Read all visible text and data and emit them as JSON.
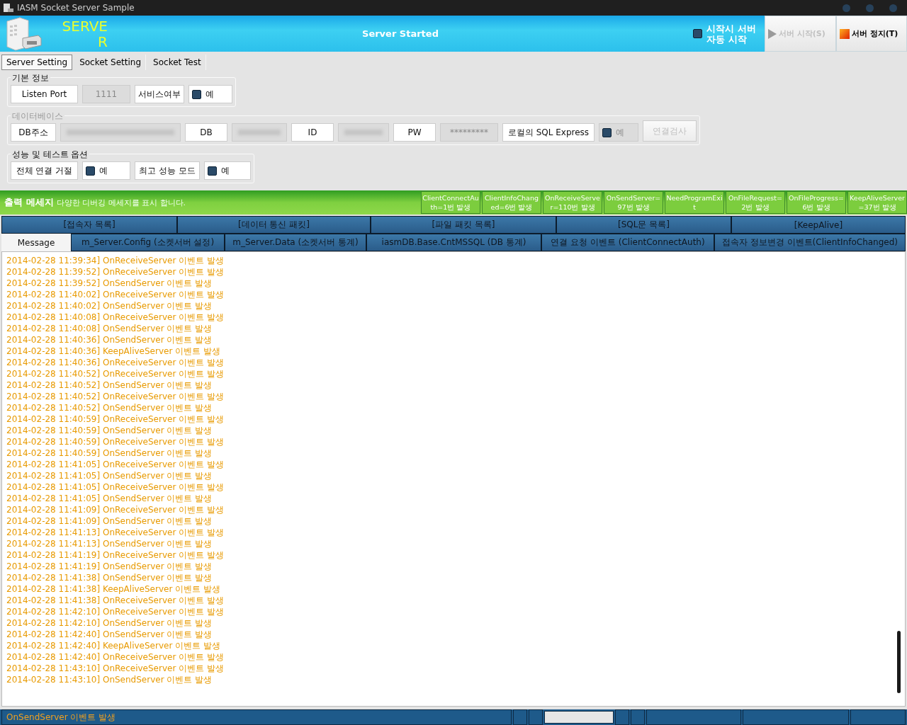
{
  "window": {
    "title": "IASM Socket Server Sample"
  },
  "header": {
    "logo_text": "SERVER",
    "status": "Server Started",
    "auto_start": {
      "label": "시작시 서버 자동 시작",
      "checked": false
    },
    "buttons": [
      {
        "label": "서버 시작(S)",
        "kind": "play",
        "disabled": true
      },
      {
        "label": "서버 정지(T)",
        "kind": "stop",
        "disabled": false
      }
    ]
  },
  "tabs": [
    {
      "label": "Server Setting",
      "selected": true
    },
    {
      "label": "Socket Setting",
      "selected": false
    },
    {
      "label": "Socket Test",
      "selected": false
    }
  ],
  "groups": [
    {
      "title": "기본 정보",
      "disabled": false,
      "items": [
        {
          "kind": "label",
          "text": "Listen Port"
        },
        {
          "kind": "value",
          "text": "1111"
        },
        {
          "kind": "label",
          "text": "서비스여부"
        },
        {
          "kind": "check",
          "text": "예",
          "checked": false,
          "disabled": false
        }
      ]
    },
    {
      "title": "데이터베이스",
      "disabled": true,
      "items": [
        {
          "kind": "label",
          "text": "DB주소"
        },
        {
          "kind": "blurred"
        },
        {
          "kind": "label",
          "text": "DB"
        },
        {
          "kind": "blurred"
        },
        {
          "kind": "label",
          "text": "ID"
        },
        {
          "kind": "blurred"
        },
        {
          "kind": "label",
          "text": "PW"
        },
        {
          "kind": "value",
          "text": "*********"
        },
        {
          "kind": "label",
          "text": "로컬의 SQL Express"
        },
        {
          "kind": "check",
          "text": "예",
          "checked": false,
          "disabled": true
        },
        {
          "kind": "button",
          "text": "연결검사",
          "disabled": true
        }
      ]
    },
    {
      "title": "성능 및 테스트 옵션",
      "disabled": false,
      "items": [
        {
          "kind": "label",
          "text": "전체 연결 거절"
        },
        {
          "kind": "check",
          "text": "예",
          "checked": false,
          "disabled": false
        },
        {
          "kind": "label",
          "text": "최고 성능 모드"
        },
        {
          "kind": "check",
          "text": "예",
          "checked": false,
          "disabled": false
        }
      ]
    }
  ],
  "output": {
    "title": "출력 메세지",
    "subtitle": "다양한 디버깅 메세지를 표시 합니다.",
    "counters": [
      "ClientConnectAuth=1번 발생",
      "ClientInfoChanged=6번 발생",
      "OnReceiveServer=110번 발생",
      "OnSendServer=97번 발생",
      "NeedProgramExit",
      "OnFileRequest=2번 발생",
      "OnFileProgress=6번 발생",
      "KeepAliveServer=37번 발생"
    ]
  },
  "tab_rows": [
    [
      {
        "label": "[접속자 목록]",
        "selected": false
      },
      {
        "label": "[데이터 통신 패킷]",
        "selected": false
      },
      {
        "label": "[파일 패킷 목록]",
        "selected": false
      },
      {
        "label": "[SQL문 목록]",
        "selected": false
      },
      {
        "label": "[KeepAlive]",
        "selected": false
      }
    ],
    [
      {
        "label": "Message",
        "selected": true
      },
      {
        "label": "m_Server.Config (소켓서버 설정)",
        "selected": false
      },
      {
        "label": "m_Server.Data  (소켓서버 통계)",
        "selected": false
      },
      {
        "label": "iasmDB.Base.CntMSSQL  (DB 통계)",
        "selected": false
      },
      {
        "label": "연결 요청 이벤트 (ClientConnectAuth)",
        "selected": false
      },
      {
        "label": "접속자 정보변경 이벤트(ClientInfoChanged)",
        "selected": false
      }
    ]
  ],
  "log": [
    "2014-02-28 11:39:34] OnReceiveServer 이벤트 발생",
    "2014-02-28 11:39:52] OnReceiveServer 이벤트 발생",
    "2014-02-28 11:39:52] OnSendServer 이벤트 발생",
    "2014-02-28 11:40:02] OnReceiveServer 이벤트 발생",
    "2014-02-28 11:40:02] OnSendServer 이벤트 발생",
    "2014-02-28 11:40:08] OnReceiveServer 이벤트 발생",
    "2014-02-28 11:40:08] OnSendServer 이벤트 발생",
    "2014-02-28 11:40:36] OnSendServer 이벤트 발생",
    "2014-02-28 11:40:36] KeepAliveServer 이벤트 발생",
    "2014-02-28 11:40:36] OnReceiveServer 이벤트 발생",
    "2014-02-28 11:40:52] OnReceiveServer 이벤트 발생",
    "2014-02-28 11:40:52] OnSendServer 이벤트 발생",
    "2014-02-28 11:40:52] OnReceiveServer 이벤트 발생",
    "2014-02-28 11:40:52] OnSendServer 이벤트 발생",
    "2014-02-28 11:40:59] OnReceiveServer 이벤트 발생",
    "2014-02-28 11:40:59] OnSendServer 이벤트 발생",
    "2014-02-28 11:40:59] OnReceiveServer 이벤트 발생",
    "2014-02-28 11:40:59] OnSendServer 이벤트 발생",
    "2014-02-28 11:41:05] OnReceiveServer 이벤트 발생",
    "2014-02-28 11:41:05] OnSendServer 이벤트 발생",
    "2014-02-28 11:41:05] OnReceiveServer 이벤트 발생",
    "2014-02-28 11:41:05] OnSendServer 이벤트 발생",
    "2014-02-28 11:41:09] OnReceiveServer 이벤트 발생",
    "2014-02-28 11:41:09] OnSendServer 이벤트 발생",
    "2014-02-28 11:41:13] OnReceiveServer 이벤트 발생",
    "2014-02-28 11:41:13] OnSendServer 이벤트 발생",
    "2014-02-28 11:41:19] OnReceiveServer 이벤트 발생",
    "2014-02-28 11:41:19] OnSendServer 이벤트 발생",
    "2014-02-28 11:41:38] OnSendServer 이벤트 발생",
    "2014-02-28 11:41:38] KeepAliveServer 이벤트 발생",
    "2014-02-28 11:41:38] OnReceiveServer 이벤트 발생",
    "2014-02-28 11:42:10] OnReceiveServer 이벤트 발생",
    "2014-02-28 11:42:10] OnSendServer 이벤트 발생",
    "2014-02-28 11:42:40] OnSendServer 이벤트 발생",
    "2014-02-28 11:42:40] KeepAliveServer 이벤트 발생",
    "2014-02-28 11:42:40] OnReceiveServer 이벤트 발생",
    "2014-02-28 11:43:10] OnReceiveServer 이벤트 발생",
    "2014-02-28 11:43:10] OnSendServer 이벤트 발생"
  ],
  "status_bar": {
    "message": "OnSendServer 이벤트 발생"
  }
}
